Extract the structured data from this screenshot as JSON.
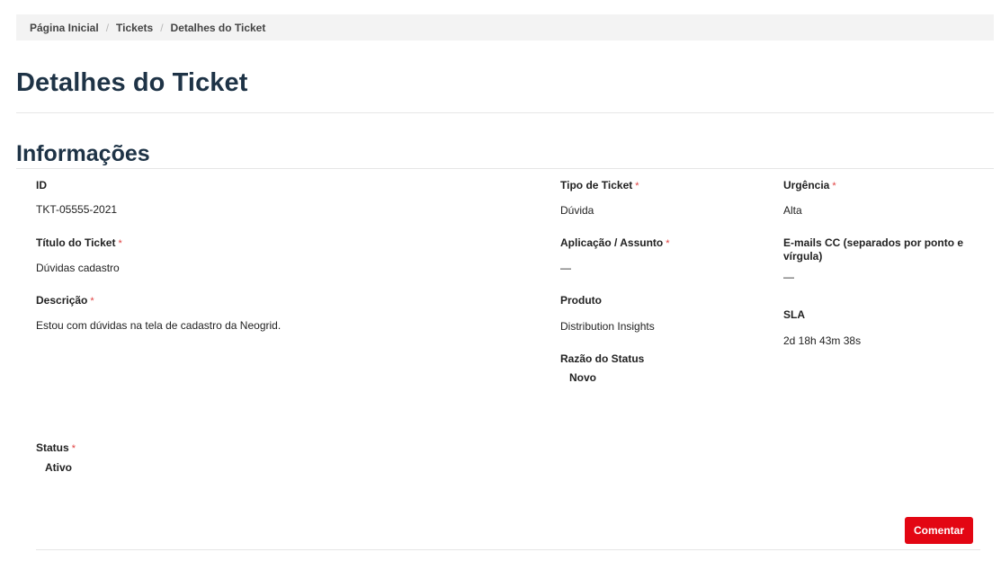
{
  "breadcrumb": {
    "items": [
      "Página Inicial",
      "Tickets",
      "Detalhes do Ticket"
    ],
    "separator": "/"
  },
  "page_title": "Detalhes do Ticket",
  "section_title": "Informações",
  "fields": {
    "id": {
      "label": "ID",
      "value": "TKT-05555-2021"
    },
    "titulo": {
      "label": "Título do Ticket",
      "value": "Dúvidas cadastro"
    },
    "descricao": {
      "label": "Descrição",
      "value": "Estou com dúvidas na tela de cadastro da Neogrid."
    },
    "status": {
      "label": "Status",
      "value": "Ativo"
    },
    "tipo": {
      "label": "Tipo de Ticket",
      "value": "Dúvida"
    },
    "aplicacao": {
      "label": "Aplicação / Assunto",
      "value": "—"
    },
    "produto": {
      "label": "Produto",
      "value": "Distribution Insights"
    },
    "razao_status": {
      "label": "Razão do Status",
      "value": "Novo"
    },
    "urgencia": {
      "label": "Urgência",
      "value": "Alta"
    },
    "emails_cc": {
      "label": "E-mails CC (separados por ponto e vírgula)",
      "value": "—"
    },
    "sla": {
      "label": "SLA",
      "value": "2d 18h 43m 38s"
    }
  },
  "required_marker": "*",
  "actions": {
    "comentar_label": "Comentar"
  },
  "colors": {
    "primary_button": "#e30613",
    "title": "#1e3346",
    "breadcrumb_bg": "#f3f3f3",
    "required": "#e04040"
  }
}
